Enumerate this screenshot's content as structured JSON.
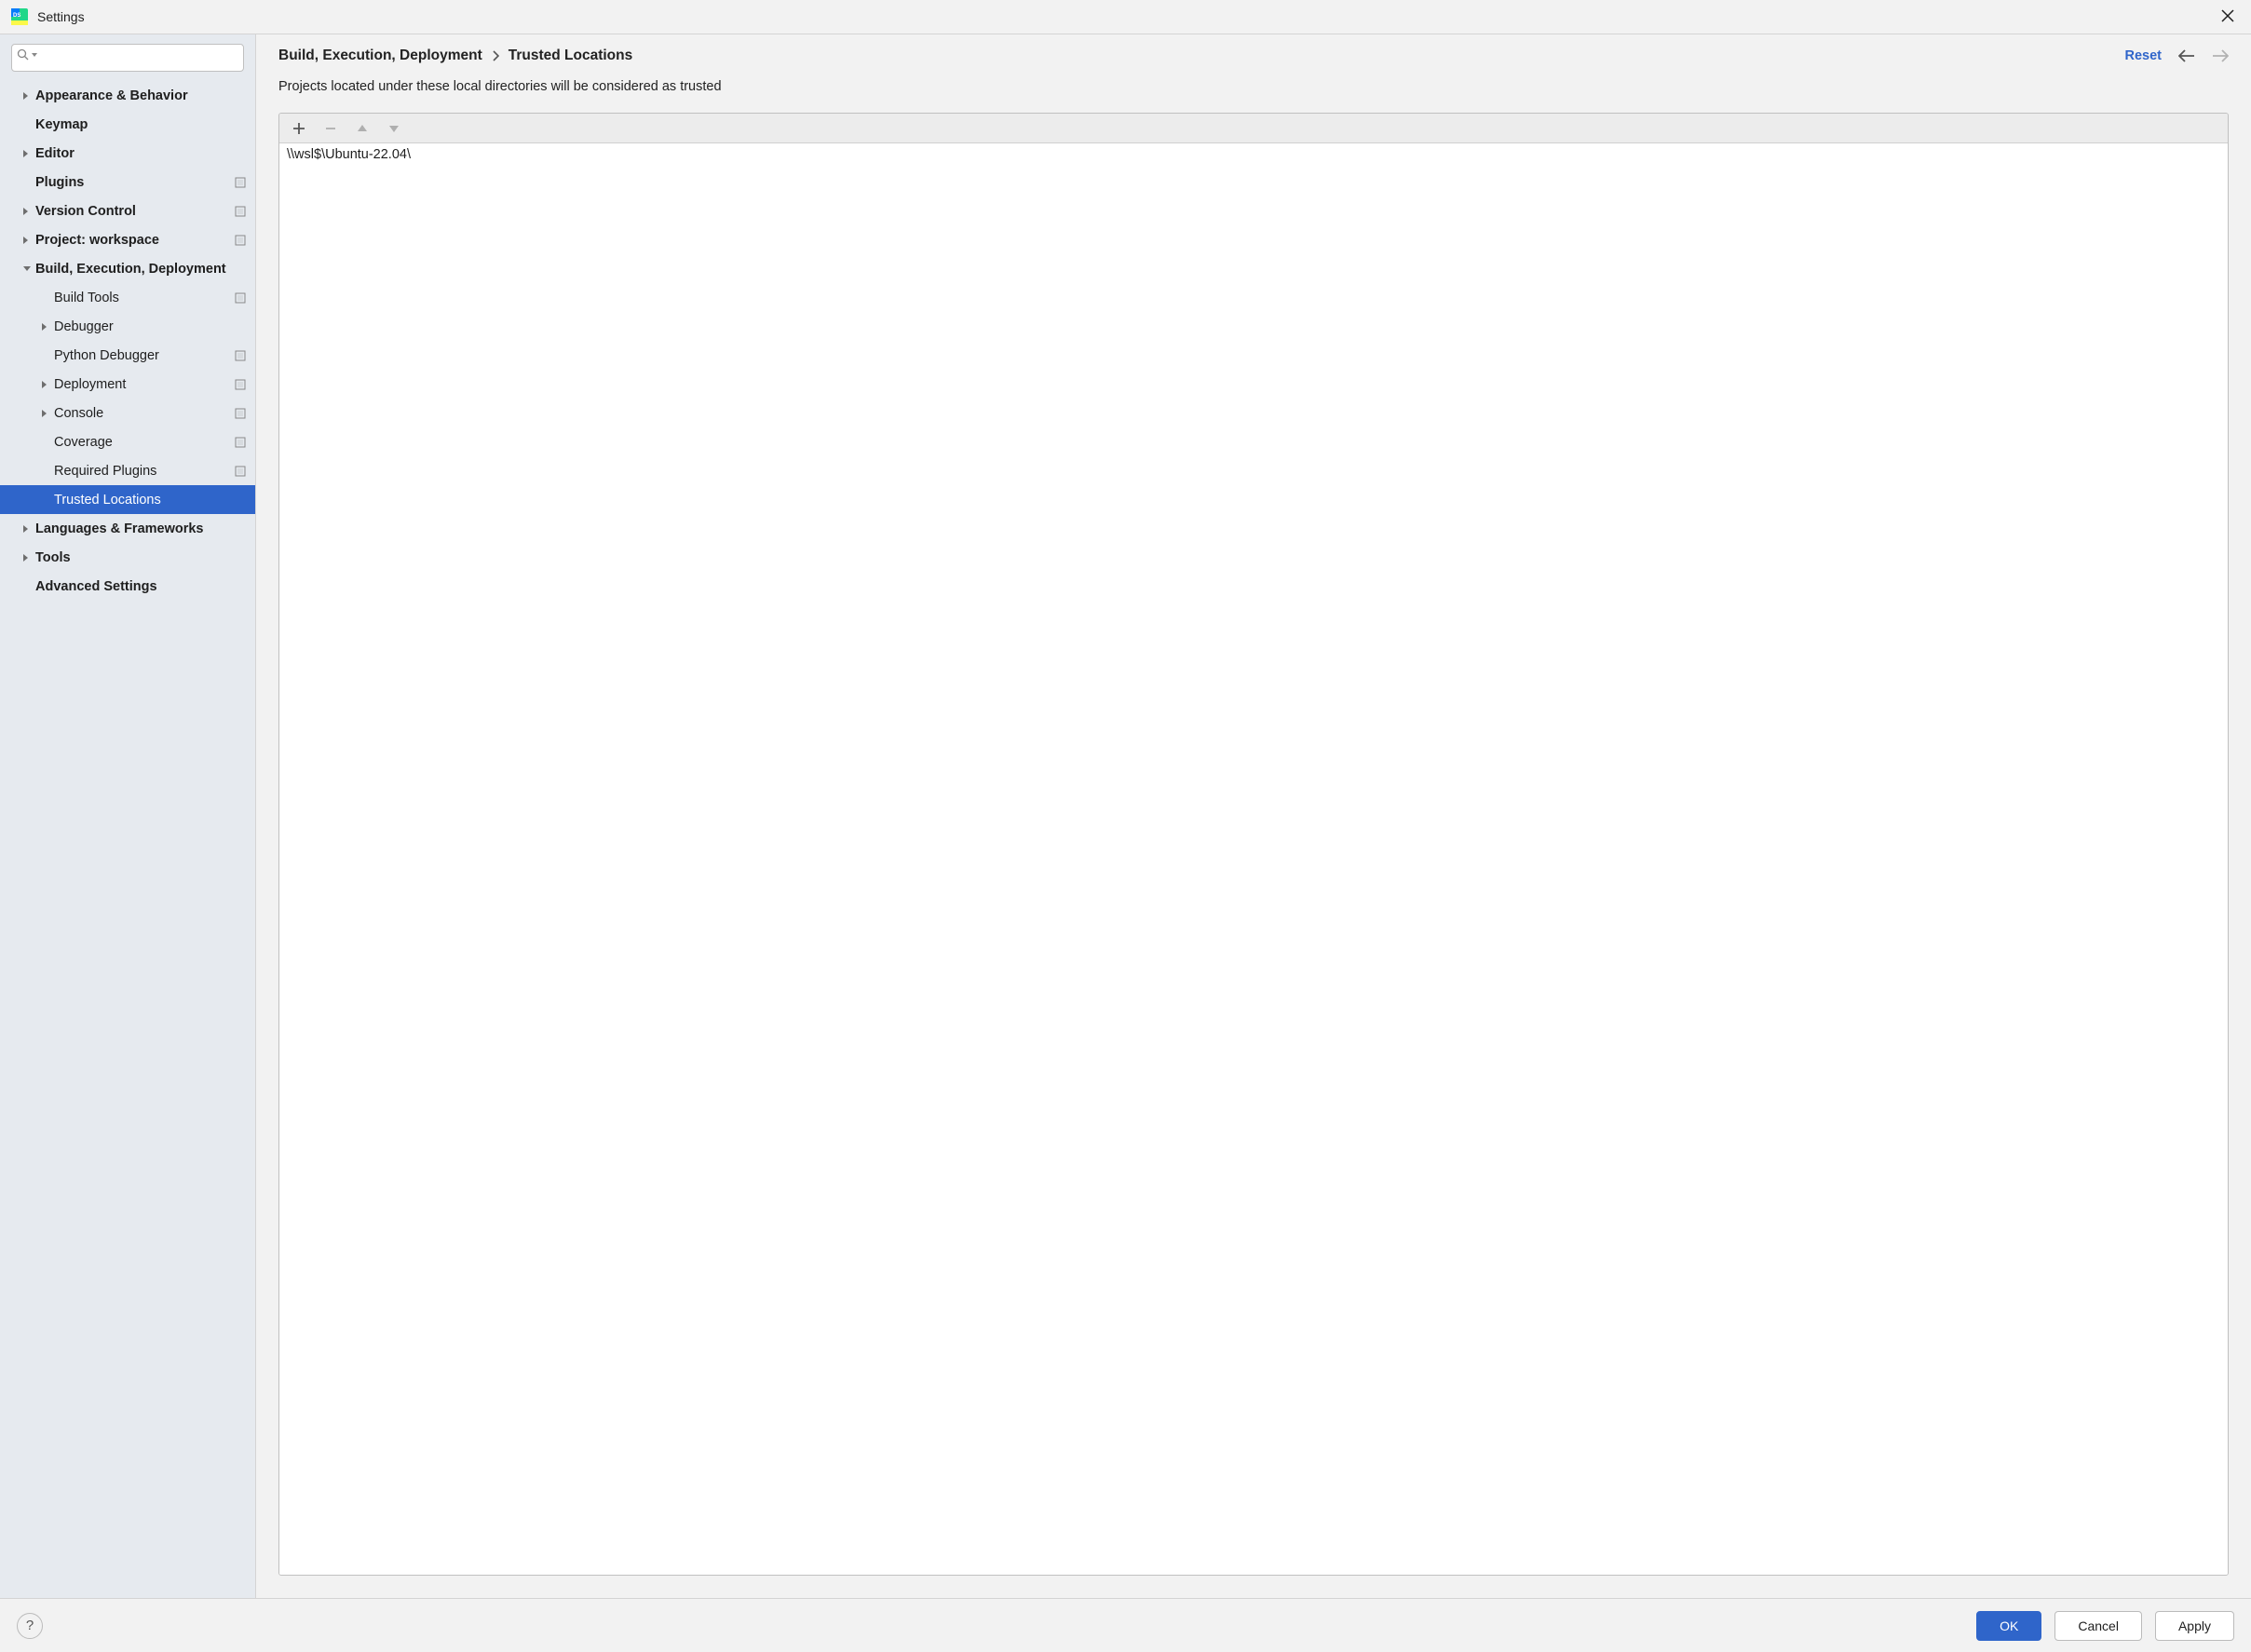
{
  "titlebar": {
    "title": "Settings"
  },
  "search": {
    "placeholder": ""
  },
  "tree": {
    "items": [
      {
        "label": "Appearance & Behavior",
        "level": 1,
        "bold": true,
        "arrow": "right",
        "box": false
      },
      {
        "label": "Keymap",
        "level": 1,
        "bold": true,
        "arrow": null,
        "box": false
      },
      {
        "label": "Editor",
        "level": 1,
        "bold": true,
        "arrow": "right",
        "box": false
      },
      {
        "label": "Plugins",
        "level": 1,
        "bold": true,
        "arrow": null,
        "box": true
      },
      {
        "label": "Version Control",
        "level": 1,
        "bold": true,
        "arrow": "right",
        "box": true
      },
      {
        "label": "Project: workspace",
        "level": 1,
        "bold": true,
        "arrow": "right",
        "box": true
      },
      {
        "label": "Build, Execution, Deployment",
        "level": 1,
        "bold": true,
        "arrow": "down",
        "box": false
      },
      {
        "label": "Build Tools",
        "level": 2,
        "bold": false,
        "arrow": null,
        "box": true
      },
      {
        "label": "Debugger",
        "level": 2,
        "bold": false,
        "arrow": "right",
        "box": false
      },
      {
        "label": "Python Debugger",
        "level": 2,
        "bold": false,
        "arrow": null,
        "box": true
      },
      {
        "label": "Deployment",
        "level": 2,
        "bold": false,
        "arrow": "right",
        "box": true
      },
      {
        "label": "Console",
        "level": 2,
        "bold": false,
        "arrow": "right",
        "box": true
      },
      {
        "label": "Coverage",
        "level": 2,
        "bold": false,
        "arrow": null,
        "box": true
      },
      {
        "label": "Required Plugins",
        "level": 2,
        "bold": false,
        "arrow": null,
        "box": true
      },
      {
        "label": "Trusted Locations",
        "level": 2,
        "bold": false,
        "arrow": null,
        "box": false,
        "selected": true
      },
      {
        "label": "Languages & Frameworks",
        "level": 1,
        "bold": true,
        "arrow": "right",
        "box": false
      },
      {
        "label": "Tools",
        "level": 1,
        "bold": true,
        "arrow": "right",
        "box": false
      },
      {
        "label": "Advanced Settings",
        "level": 1,
        "bold": true,
        "arrow": null,
        "box": false
      }
    ]
  },
  "breadcrumb": {
    "parent": "Build, Execution, Deployment",
    "leaf": "Trusted Locations"
  },
  "header": {
    "reset": "Reset"
  },
  "description": "Projects located under these local directories will be considered as trusted",
  "locations": [
    "\\\\wsl$\\Ubuntu-22.04\\"
  ],
  "footer": {
    "ok": "OK",
    "cancel": "Cancel",
    "apply": "Apply",
    "help": "?"
  }
}
